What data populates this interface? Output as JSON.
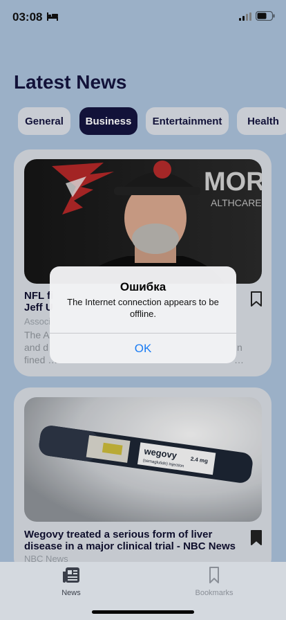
{
  "status_bar": {
    "time": "03:08"
  },
  "header": {
    "title": "Latest News"
  },
  "categories": [
    {
      "label": "General",
      "active": false
    },
    {
      "label": "Business",
      "active": true
    },
    {
      "label": "Entertainment",
      "active": false
    },
    {
      "label": "Health",
      "active": false
    }
  ],
  "articles": [
    {
      "title": "NFL fi… Jeff U…",
      "title_line1": "NFL fi",
      "title_line2": "Jeff U",
      "source": "Associ",
      "desc_line1": "The A",
      "desc_line2": "and d",
      "desc_line3": "fined …",
      "desc_tail_line2": "n",
      "desc_tail_line3": "…",
      "bookmarked": false
    },
    {
      "title": "Wegovy treated a serious form of liver disease in a major clinical trial - NBC News",
      "source": "NBC News",
      "bookmarked": true
    }
  ],
  "alert": {
    "title": "Ошибка",
    "message": "The Internet connection appears to be offline.",
    "ok_label": "OK"
  },
  "tab_bar": {
    "items": [
      {
        "label": "News",
        "icon": "newspaper-icon",
        "active": true
      },
      {
        "label": "Bookmarks",
        "icon": "bookmark-icon",
        "active": false
      }
    ]
  },
  "image_text": {
    "brand_text": "MORY",
    "brand_subtext": "ALTHCARE",
    "product_name": "wegovy",
    "product_dose": "2.4 mg",
    "product_sub": "(semaglutide) injection"
  },
  "colors": {
    "background": "#a9bfd8",
    "accent_dark": "#14143e",
    "link_blue": "#1a7cf3"
  }
}
